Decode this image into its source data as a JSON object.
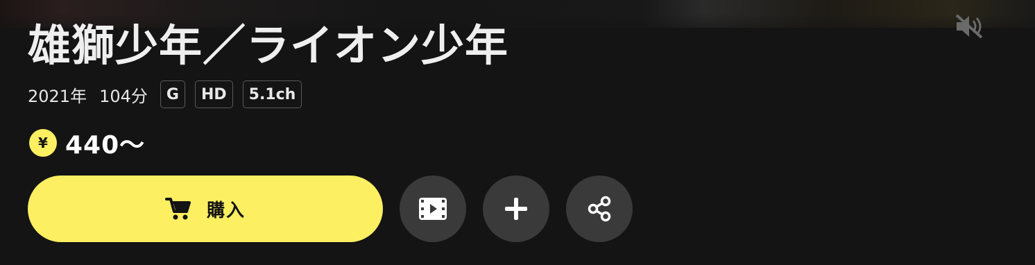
{
  "title": "雄獅少年／ライオン少年",
  "meta": {
    "year": "2021年",
    "duration": "104分",
    "badges": [
      "G",
      "HD",
      "5.1ch"
    ]
  },
  "price": {
    "symbol": "¥",
    "text": "440〜"
  },
  "actions": {
    "buy_label": "購入"
  },
  "colors": {
    "accent": "#fcef61",
    "background": "#141414",
    "round_button": "#3a3a3a"
  },
  "icons": {
    "mute": "speaker-muted-icon",
    "cart": "cart-icon",
    "trailer": "film-play-icon",
    "add": "plus-icon",
    "share": "share-icon"
  }
}
